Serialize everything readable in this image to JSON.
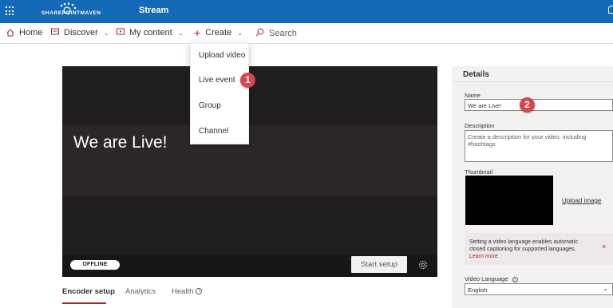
{
  "topbar": {
    "logo_text": "SHAREPOINTMAVEN",
    "app_title": "Stream"
  },
  "nav": {
    "home": "Home",
    "discover": "Discover",
    "my_content": "My content",
    "create": "Create",
    "search_placeholder": "Search"
  },
  "create_menu": {
    "items": [
      "Upload video",
      "Live event",
      "Group",
      "Channel"
    ]
  },
  "badges": [
    "1",
    "2"
  ],
  "player": {
    "title": "We are Live!",
    "status": "OFFLINE",
    "start_setup": "Start setup"
  },
  "tabs": [
    "Encoder setup",
    "Analytics",
    "Health"
  ],
  "details": {
    "header": "Details",
    "name_label": "Name",
    "name_value": "We are Live!",
    "description_label": "Description",
    "description_placeholder": "Create a description for your video, including #hashtags",
    "thumbnail_label": "Thumbnail",
    "upload_image": "Upload image",
    "notice_text": "Setting a video language enables automatic closed captioning for supported languages.",
    "notice_link": "Learn more",
    "video_language_label": "Video Language",
    "video_language_value": "English"
  },
  "colors": {
    "topbar": "#1469b8",
    "accent": "#a4262c",
    "badge": "#d64550"
  }
}
